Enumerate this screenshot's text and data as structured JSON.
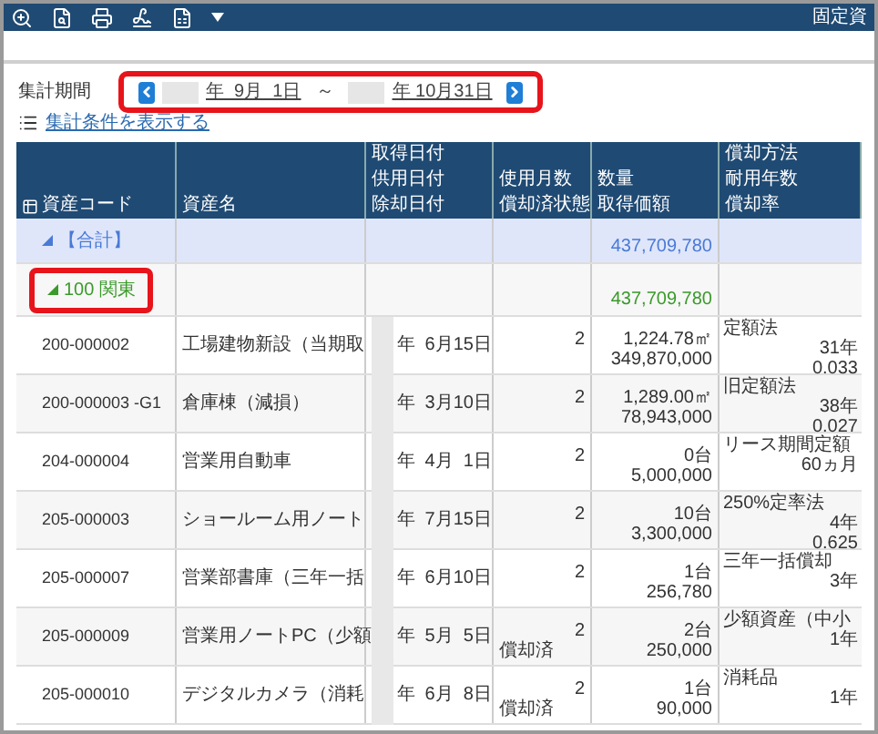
{
  "toolbar": {
    "title": "固定資"
  },
  "period": {
    "label": "集計期間",
    "start": "年  9月  1日",
    "separator": "～",
    "end": "年 10月31日",
    "link": "集計条件を表示する"
  },
  "table": {
    "columns": [
      [
        "資産コード"
      ],
      [
        "資産名"
      ],
      [
        "取得日付",
        "供用日付",
        "除却日付"
      ],
      [
        "使用月数",
        "償却済状態"
      ],
      [
        "数量",
        "取得価額"
      ],
      [
        "償却方法",
        "耐用年数",
        "償却率"
      ]
    ],
    "groups": [
      {
        "kind": "total",
        "label": "【合計】",
        "amount": "437,709,780",
        "expanded": true,
        "highlighted": false
      },
      {
        "kind": "region",
        "label": "100 関東",
        "amount": "437,709,780",
        "expanded": true,
        "highlighted": true
      }
    ],
    "rows": [
      {
        "code": "200-000002",
        "name": "工場建物新設（当期取",
        "date": "年  6月15日",
        "months": "2",
        "quantity": "1,224.78㎡",
        "amount": "349,870,000",
        "method": "定額法",
        "life": "31年",
        "rate": "0.033"
      },
      {
        "code": "200-000003 -G1",
        "name": "倉庫棟（減損）",
        "date": "年  3月10日",
        "months": "2",
        "quantity": "1,289.00㎡",
        "amount": "78,943,000",
        "method": "旧定額法",
        "life": "38年",
        "rate": "0.027"
      },
      {
        "code": "204-000004",
        "name": "営業用自動車",
        "date": "年  4月  1日",
        "months": "2",
        "quantity": "0台",
        "amount": "5,000,000",
        "method": "リース期間定額",
        "life": "60ヵ月"
      },
      {
        "code": "205-000003",
        "name": "ショールーム用ノート",
        "date": "年  7月15日",
        "months": "2",
        "quantity": "10台",
        "amount": "3,300,000",
        "method": "250%定率法",
        "life": "4年",
        "rate": "0.625"
      },
      {
        "code": "205-000007",
        "name": "営業部書庫（三年一括",
        "date": "年  6月10日",
        "months": "2",
        "quantity": "1台",
        "amount": "256,780",
        "method": "三年一括償却",
        "life": "3年"
      },
      {
        "code": "205-000009",
        "name": "営業用ノートPC（少額",
        "date": "年  5月  5日",
        "months": "2",
        "status": "償却済",
        "quantity": "2台",
        "amount": "250,000",
        "method": "少額資産（中小",
        "life": "1年"
      },
      {
        "code": "205-000010",
        "name": "デジタルカメラ（消耗",
        "date": "年  6月  8日",
        "months": "2",
        "status": "償却済",
        "quantity": "1台",
        "amount": "90,000",
        "method": "消耗品",
        "life": "1年"
      }
    ]
  }
}
